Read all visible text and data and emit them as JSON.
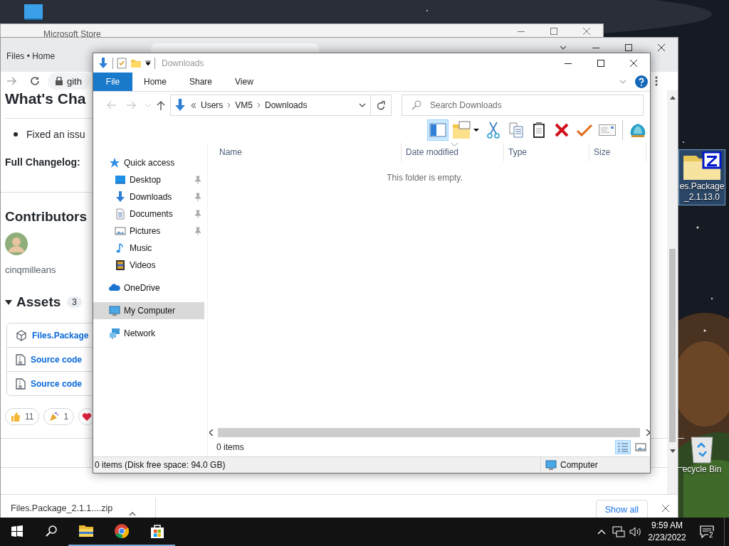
{
  "desktop": {
    "icons": [
      {
        "kind": "computer",
        "selected": false
      },
      {
        "kind": "zip-folder",
        "selected": true,
        "label_lines": [
          "es.Package",
          "_2.1.13.0"
        ]
      },
      {
        "kind": "recycle-bin",
        "selected": false,
        "label_lines": [
          "ecycle Bin"
        ]
      }
    ]
  },
  "store_window": {
    "title": "Microsoft Store"
  },
  "browser": {
    "tab": {
      "title": "Files • Home"
    },
    "address": "gith",
    "page": {
      "heading": "What's Cha",
      "bullets": [
        "Fixed an issu"
      ],
      "changelog_label": "Full Changelog:",
      "contributors_heading": "Contributors",
      "contributors": [
        {
          "name": "cinqmilleans"
        }
      ],
      "assets_heading": "Assets",
      "assets_count": "3",
      "assets_expanded": true,
      "assets": [
        {
          "kind": "package",
          "name": "Files.Package"
        },
        {
          "kind": "zip",
          "name": "Source code"
        },
        {
          "kind": "zip",
          "name": "Source code"
        }
      ],
      "reactions": [
        {
          "kind": "thumbs-up",
          "count": "11"
        },
        {
          "kind": "party",
          "count": "1"
        },
        {
          "kind": "heart"
        }
      ]
    },
    "download": {
      "file": "Files.Package_2.1.1....zip",
      "show_all": "Show all"
    }
  },
  "explorer": {
    "title": "Downloads",
    "ribbon_tabs": [
      {
        "label": "File",
        "kind": "file",
        "selected": false
      },
      {
        "label": "Home",
        "kind": "tab",
        "selected": false
      },
      {
        "label": "Share",
        "kind": "tab",
        "selected": false
      },
      {
        "label": "View",
        "kind": "tab",
        "selected": false
      }
    ],
    "path": [
      "Users",
      "VM5",
      "Downloads"
    ],
    "search_placeholder": "Search Downloads",
    "toolbar": [
      {
        "kind": "preview-pane",
        "selected": true
      },
      {
        "kind": "new-folder",
        "selected": false
      },
      {
        "kind": "cut",
        "selected": false
      },
      {
        "kind": "copy",
        "selected": false
      },
      {
        "kind": "paste",
        "selected": false
      },
      {
        "kind": "delete",
        "selected": false
      },
      {
        "kind": "check",
        "selected": false
      },
      {
        "kind": "properties",
        "selected": false
      },
      {
        "kind": "shell",
        "selected": false
      }
    ],
    "nav": [
      {
        "label": "Quick access",
        "kind": "star",
        "selected": false,
        "children": [
          {
            "label": "Desktop",
            "kind": "desktop",
            "selected": false,
            "pinned": true
          },
          {
            "label": "Downloads",
            "kind": "download",
            "selected": false,
            "pinned": true
          },
          {
            "label": "Documents",
            "kind": "document",
            "selected": false,
            "pinned": true
          },
          {
            "label": "Pictures",
            "kind": "pictures",
            "selected": false,
            "pinned": true
          },
          {
            "label": "Music",
            "kind": "music",
            "selected": false,
            "pinned": false
          },
          {
            "label": "Videos",
            "kind": "videos",
            "selected": false,
            "pinned": false
          }
        ]
      },
      {
        "label": "OneDrive",
        "kind": "cloud",
        "selected": false
      },
      {
        "label": "My Computer",
        "kind": "computer",
        "selected": true
      },
      {
        "label": "Network",
        "kind": "network",
        "selected": false
      }
    ],
    "columns": [
      {
        "label": "Name",
        "sorted": false
      },
      {
        "label": "Date modified",
        "sorted": true
      },
      {
        "label": "Type",
        "sorted": false
      },
      {
        "label": "Size",
        "sorted": false
      }
    ],
    "empty_message": "This folder is empty.",
    "item_count": "0 items",
    "view_buttons": [
      {
        "kind": "details",
        "selected": true
      },
      {
        "kind": "large-icons",
        "selected": false
      }
    ],
    "status": "0 items (Disk free space: 94.0 GB)",
    "status_location": "Computer"
  },
  "taskbar": {
    "apps": [
      {
        "kind": "explorer",
        "running": true
      },
      {
        "kind": "chrome",
        "running": true
      },
      {
        "kind": "store",
        "running": true
      }
    ],
    "time": "9:59 AM",
    "date": "2/23/2022",
    "notifications": "2"
  }
}
